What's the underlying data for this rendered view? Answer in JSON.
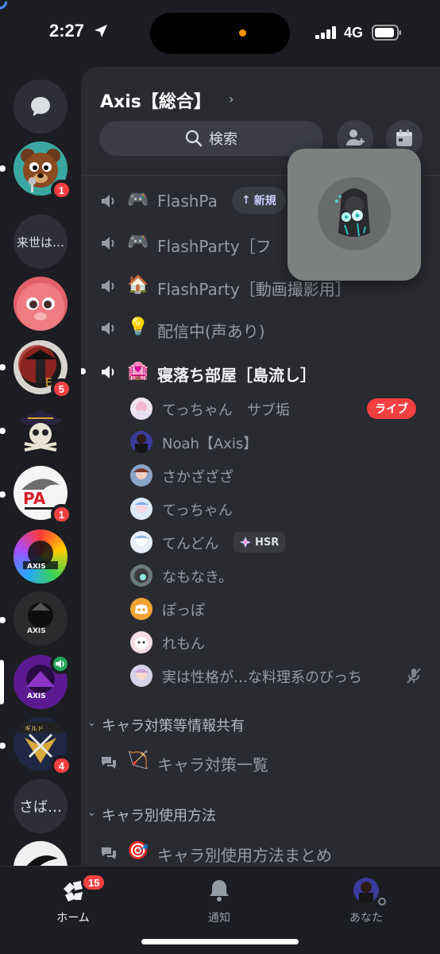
{
  "status_bar": {
    "time": "2:27",
    "network": "4G"
  },
  "server": {
    "name": "Axis【総合】",
    "search_label": "検索",
    "new_label": "新規"
  },
  "rail": {
    "items": [
      {
        "kind": "dm"
      },
      {
        "kind": "server",
        "badge": "1"
      },
      {
        "kind": "text",
        "label": "来世は…"
      },
      {
        "kind": "server"
      },
      {
        "kind": "server",
        "badge": "5"
      },
      {
        "kind": "server"
      },
      {
        "kind": "server",
        "badge": "1"
      },
      {
        "kind": "server"
      },
      {
        "kind": "server"
      },
      {
        "kind": "server",
        "speaking": true
      },
      {
        "kind": "server",
        "badge": "4"
      },
      {
        "kind": "text",
        "label": "さば…"
      }
    ]
  },
  "channels": [
    {
      "emoji": "🎮",
      "name": "FlashPa"
    },
    {
      "emoji": "🎮",
      "name": "FlashParty［フ"
    },
    {
      "emoji": "🏠",
      "name": "FlashParty［動画撮影用］"
    },
    {
      "emoji": "💡",
      "name": "配信中(声あり)"
    },
    {
      "emoji": "🏩",
      "name": "寝落ち部屋［島流し］"
    }
  ],
  "voice_users": [
    {
      "name": "てっちゃん　サブ垢",
      "live": "ライブ"
    },
    {
      "name": "Noah【Axis】"
    },
    {
      "name": "さかざざざ"
    },
    {
      "name": "てっちゃん"
    },
    {
      "name": "てんどん",
      "tag": "HSR"
    },
    {
      "name": "なもなき。"
    },
    {
      "name": "ぽっぽ"
    },
    {
      "name": "れもん"
    },
    {
      "name": "実は性格が…な料理系のびっち",
      "muted": true
    }
  ],
  "categories": [
    {
      "name": "キャラ対策等情報共有",
      "forum": {
        "emoji": "🏹",
        "name": "キャラ対策一覧"
      }
    },
    {
      "name": "キャラ別使用方法",
      "forum": {
        "emoji": "🎯",
        "name": "キャラ別使用方法まとめ"
      }
    }
  ],
  "tabbar": {
    "home": {
      "label": "ホーム",
      "badge": "15"
    },
    "notifications": {
      "label": "通知"
    },
    "you": {
      "label": "あなた"
    }
  },
  "colors": {
    "background": "#1c1d22",
    "panel": "#2a2b31",
    "badge_red": "#f23f43",
    "accent": "#5865f2",
    "online_green": "#23a55a"
  }
}
